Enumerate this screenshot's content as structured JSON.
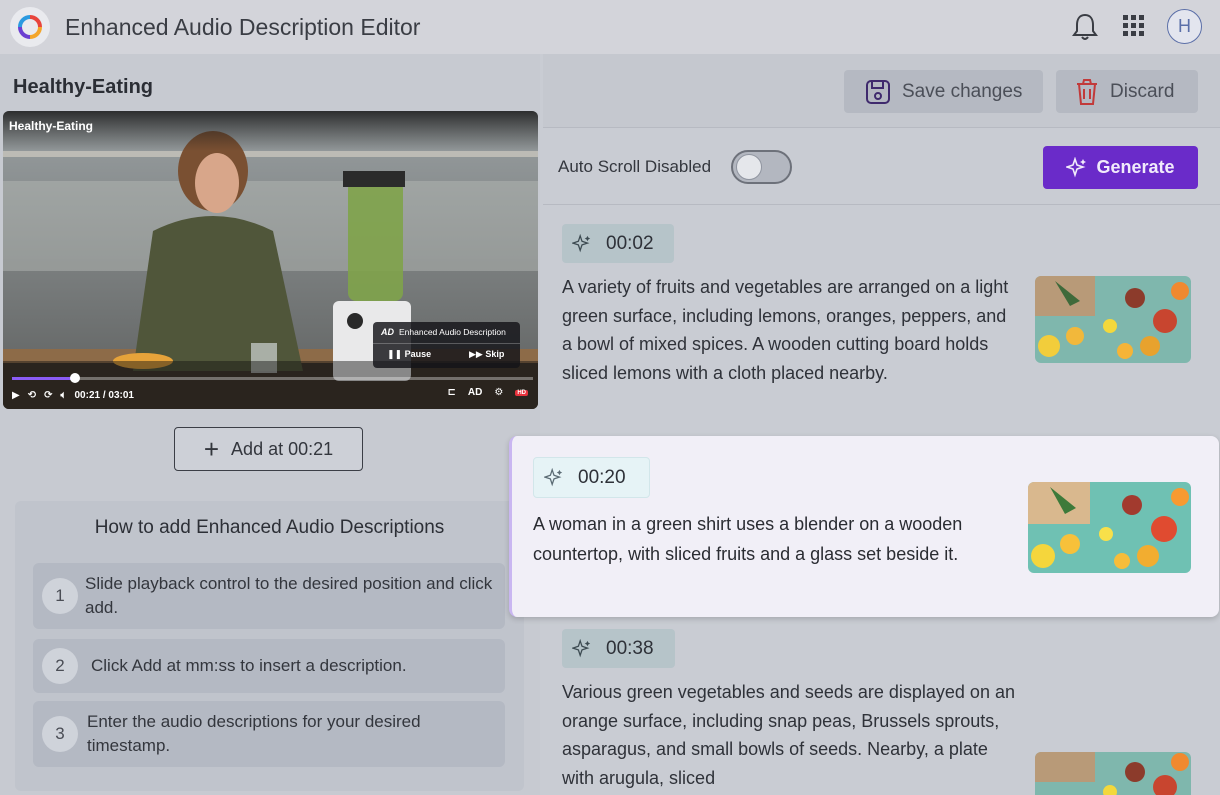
{
  "app": {
    "title": "Enhanced Audio Description Editor",
    "avatar_initial": "H"
  },
  "video": {
    "name": "Healthy-Eating",
    "overlay_title": "Healthy-Eating",
    "time_display": "00:21 / 03:01",
    "progress": 0.12,
    "ad_badge": "AD",
    "ad_label": "Enhanced Audio Description",
    "pause_label": "Pause",
    "skip_label": "Skip",
    "hd_badge": "HD"
  },
  "add_button": {
    "label": "Add at 00:21"
  },
  "howto": {
    "title": "How to add Enhanced Audio Descriptions",
    "steps": [
      {
        "num": "1",
        "text": "Slide playback control to the desired position and click add."
      },
      {
        "num": "2",
        "text": "Click Add at mm:ss to insert a description."
      },
      {
        "num": "3",
        "text": "Enter the audio descriptions for your desired timestamp."
      }
    ]
  },
  "toolbar": {
    "save_label": "Save changes",
    "discard_label": "Discard"
  },
  "controls": {
    "auto_scroll_label": "Auto Scroll Disabled",
    "auto_scroll_on": false,
    "generate_label": "Generate"
  },
  "descriptions": [
    {
      "time": "00:02",
      "text": "A variety of fruits and vegetables are arranged on a light green surface, including lemons, oranges, peppers, and a bowl of mixed spices. A wooden cutting board holds sliced lemons with a cloth placed nearby."
    },
    {
      "time": "00:20",
      "text": "A woman in a green shirt uses a blender on a wooden countertop, with sliced fruits and a glass set beside it."
    },
    {
      "time": "00:38",
      "text": "Various green vegetables and seeds are displayed on an orange surface, including snap peas, Brussels sprouts, asparagus, and small bowls of seeds. Nearby, a plate with arugula, sliced"
    }
  ],
  "colors": {
    "accent": "#6a2bc9",
    "progress": "#8b5cf6",
    "selected_card": "#f1eff7"
  }
}
